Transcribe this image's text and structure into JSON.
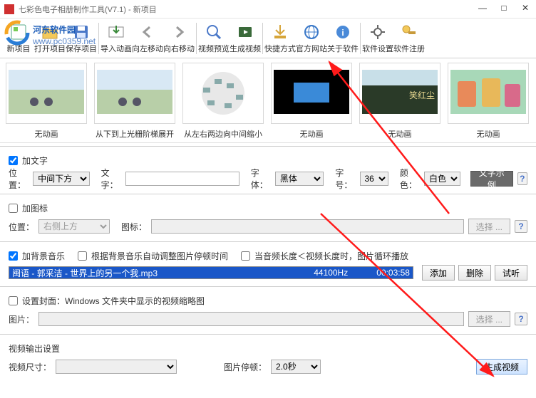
{
  "window": {
    "title": "七彩色电子相册制作工具(V7.1) - 新项目"
  },
  "winbtn": {
    "min": "—",
    "max": "□",
    "close": "✕"
  },
  "watermark": {
    "line1": "河东软件园",
    "line2": "www.pc0359.net"
  },
  "toolbar": {
    "new": "新项目",
    "open": "打开项目",
    "save": "保存项目",
    "import": "导入动画",
    "left": "向左移动",
    "right": "向右移动",
    "preview": "视频预览",
    "generate": "生成视频",
    "shortcut": "快捷方式",
    "website": "官方网站",
    "about": "关于软件",
    "settings": "软件设置",
    "register": "软件注册"
  },
  "thumbs": [
    {
      "cap": "无动画"
    },
    {
      "cap": "从下到上光栅阶梯展开"
    },
    {
      "cap": "从左右两边向中间缩小"
    },
    {
      "cap": "无动画"
    },
    {
      "cap": "无动画"
    },
    {
      "cap": "无动画"
    }
  ],
  "text": {
    "chk": "加文字",
    "pos": "位置：",
    "posv": "中间下方",
    "word": "文字：",
    "font": "字体：",
    "fontv": "黑体",
    "size": "字号：",
    "sizev": "36",
    "color": "颜色：",
    "colorv": "白色",
    "sample": "文字示例"
  },
  "icon": {
    "chk": "加图标",
    "pos": "位置：",
    "posv": "右侧上方",
    "img": "图标：",
    "browse": "选择 ..."
  },
  "music": {
    "chk": "加背景音乐",
    "adj": "根据背景音乐自动调整图片停顿时间",
    "loop": "当音频长度＜视频长度时，图片循环播放",
    "item": "闽语 - 郭采洁 - 世界上的另一个我.mp3",
    "hz": "44100Hz",
    "dur": "00:03:58",
    "add": "添加",
    "del": "删除",
    "try": "试听"
  },
  "cover": {
    "chk": "设置封面：Windows 文件夹中显示的视频缩略图",
    "img": "图片：",
    "browse": "选择 ..."
  },
  "output": {
    "title": "视频输出设置",
    "size": "视频尺寸：",
    "pause": "图片停顿：",
    "pausev": "2.0秒",
    "gen": "生成视频"
  }
}
